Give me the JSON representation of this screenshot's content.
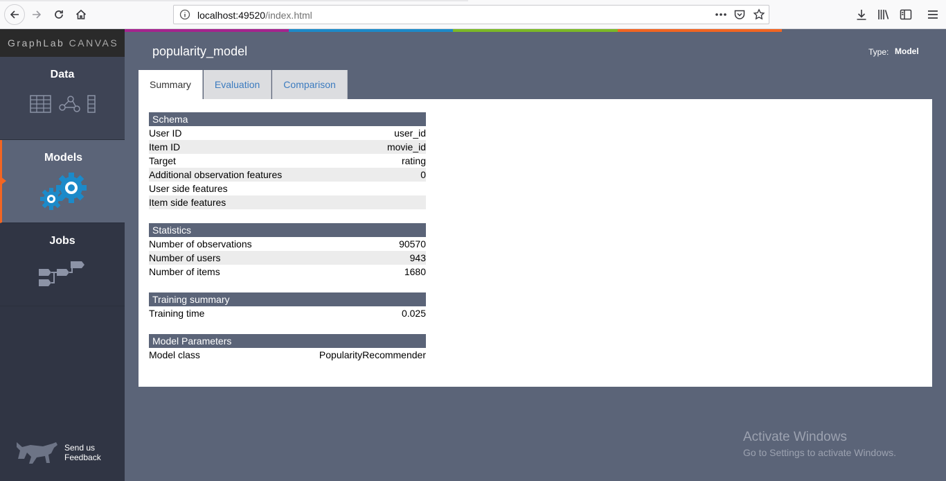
{
  "browser": {
    "url_host": "localhost:49520",
    "url_path": "/index.html"
  },
  "sidebar": {
    "brand_first": "GraphLab",
    "brand_second": "CANVAS",
    "items": [
      {
        "label": "Data"
      },
      {
        "label": "Models"
      },
      {
        "label": "Jobs"
      }
    ],
    "feedback_line1": "Send us",
    "feedback_line2": "Feedback"
  },
  "accent_colors": [
    "#5b6478",
    "#a5238e",
    "#1c8ac9",
    "#7cb927",
    "#f26522",
    "#5b6478"
  ],
  "header": {
    "title": "popularity_model",
    "type_label": "Type:",
    "type_value": "Model"
  },
  "tabs": [
    {
      "label": "Summary"
    },
    {
      "label": "Evaluation"
    },
    {
      "label": "Comparison"
    }
  ],
  "sections": [
    {
      "heading": "Schema",
      "rows": [
        {
          "key": "User ID",
          "value": "user_id"
        },
        {
          "key": "Item ID",
          "value": "movie_id"
        },
        {
          "key": "Target",
          "value": "rating"
        },
        {
          "key": "Additional observation features",
          "value": "0"
        },
        {
          "key": "User side features",
          "value": ""
        },
        {
          "key": "Item side features",
          "value": ""
        }
      ]
    },
    {
      "heading": "Statistics",
      "rows": [
        {
          "key": "Number of observations",
          "value": "90570"
        },
        {
          "key": "Number of users",
          "value": "943"
        },
        {
          "key": "Number of items",
          "value": "1680"
        }
      ]
    },
    {
      "heading": "Training summary",
      "rows": [
        {
          "key": "Training time",
          "value": "0.025"
        }
      ]
    },
    {
      "heading": "Model Parameters",
      "rows": [
        {
          "key": "Model class",
          "value": "PopularityRecommender"
        }
      ]
    }
  ],
  "watermark": {
    "line1": "Activate Windows",
    "line2": "Go to Settings to activate Windows."
  }
}
